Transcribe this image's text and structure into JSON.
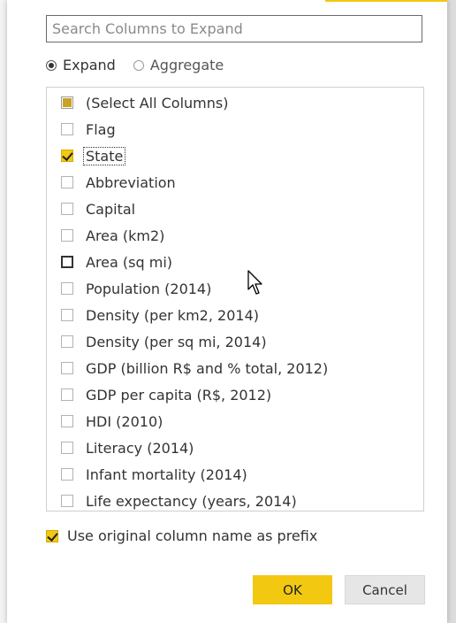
{
  "search": {
    "placeholder": "Search Columns to Expand",
    "value": ""
  },
  "mode": {
    "options": [
      {
        "label": "Expand",
        "selected": true
      },
      {
        "label": "Aggregate",
        "selected": false
      }
    ]
  },
  "columns": {
    "items": [
      {
        "label": "(Select All Columns)",
        "state": "partial"
      },
      {
        "label": "Flag",
        "state": "unchecked"
      },
      {
        "label": "State",
        "state": "checked"
      },
      {
        "label": "Abbreviation",
        "state": "unchecked"
      },
      {
        "label": "Capital",
        "state": "unchecked"
      },
      {
        "label": "Area (km2)",
        "state": "unchecked"
      },
      {
        "label": "Area (sq mi)",
        "state": "unchecked"
      },
      {
        "label": "Population (2014)",
        "state": "unchecked"
      },
      {
        "label": "Density (per km2, 2014)",
        "state": "unchecked"
      },
      {
        "label": "Density (per sq mi, 2014)",
        "state": "unchecked"
      },
      {
        "label": "GDP (billion R$ and % total, 2012)",
        "state": "unchecked"
      },
      {
        "label": "GDP per capita (R$, 2012)",
        "state": "unchecked"
      },
      {
        "label": "HDI (2010)",
        "state": "unchecked"
      },
      {
        "label": "Literacy (2014)",
        "state": "unchecked"
      },
      {
        "label": "Infant mortality (2014)",
        "state": "unchecked"
      },
      {
        "label": "Life expectancy (years, 2014)",
        "state": "unchecked"
      }
    ]
  },
  "prefix": {
    "label": "Use original column name as prefix",
    "checked": true
  },
  "buttons": {
    "ok": "OK",
    "cancel": "Cancel"
  },
  "colors": {
    "accent": "#f2c811",
    "text": "#333333",
    "border": "#cfcfcf"
  }
}
